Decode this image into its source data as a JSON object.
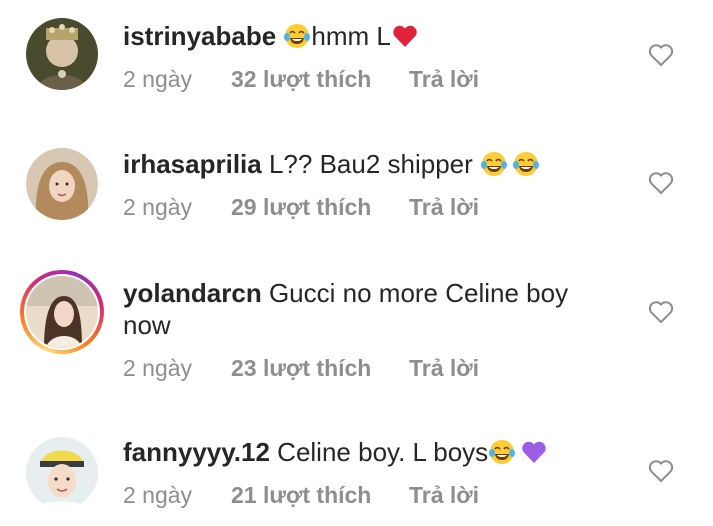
{
  "comments": [
    {
      "username": "istrinyababe",
      "text_before": "",
      "text_after": "hmm L",
      "emojis": [
        "face-with-tears-of-joy",
        "red-heart"
      ],
      "time": "2 ngày",
      "likes": "32 lượt thích",
      "reply": "Trả lời"
    },
    {
      "username": "irhasaprilia",
      "text_before": "L?? Bau2 shipper ",
      "emojis": [
        "face-with-tears-of-joy",
        "face-with-tears-of-joy"
      ],
      "time": "2 ngày",
      "likes": "29 lượt thích",
      "reply": "Trả lời"
    },
    {
      "username": "yolandarcn",
      "text": "Gucci no more Celine boy now",
      "time": "2 ngày",
      "likes": "23 lượt thích",
      "reply": "Trả lời"
    },
    {
      "username": "fannyyyy.12",
      "text_before": "Celine boy. L boys",
      "emojis": [
        "face-with-tears-of-joy",
        "purple-heart"
      ],
      "time": "2 ngày",
      "likes": "21 lượt thích",
      "reply": "Trả lời"
    }
  ],
  "colors": {
    "text": "#262626",
    "meta": "#8e8e8e",
    "red_heart": "#e0233a",
    "purple_heart": "#9b5de5",
    "story_ring": "#d62976"
  }
}
